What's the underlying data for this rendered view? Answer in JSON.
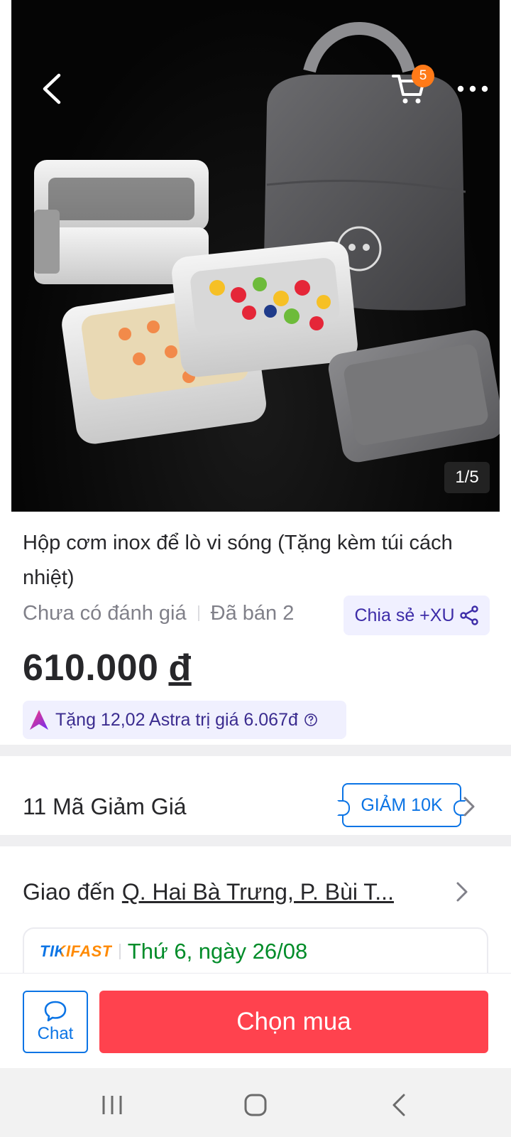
{
  "hero": {
    "cart_count": "5",
    "image_counter": "1/5",
    "icons": {
      "back": "chevron-left-icon",
      "cart": "cart-icon",
      "more": "more-dots-icon"
    }
  },
  "product": {
    "title": "Hộp cơm inox để lò vi sóng (Tặng kèm túi cách nhiệt)",
    "rating_text": "Chưa có đánh giá",
    "sold_text": "Đã bán 2",
    "share_label": "Chia sẻ +XU",
    "price": "610.000",
    "currency": "đ",
    "astra_reward": "Tặng 12,02 Astra trị giá 6.067đ"
  },
  "coupons": {
    "title": "11 Mã Giảm Giá",
    "tag": "GIẢM 10K"
  },
  "delivery": {
    "prefix": "Giao đến",
    "address": "Q. Hai Bà Trưng, P. Bùi T...",
    "service_logo": "TIKIFAST",
    "date": "Thứ 6, ngày 26/08"
  },
  "actions": {
    "chat_label": "Chat",
    "buy_label": "Chọn mua"
  },
  "colors": {
    "primary_blue": "#0b74e5",
    "buy_red": "#ff424e",
    "badge_orange": "#ff7a18",
    "delivery_green": "#008c29",
    "astra_purple": "#3b2c8f"
  }
}
